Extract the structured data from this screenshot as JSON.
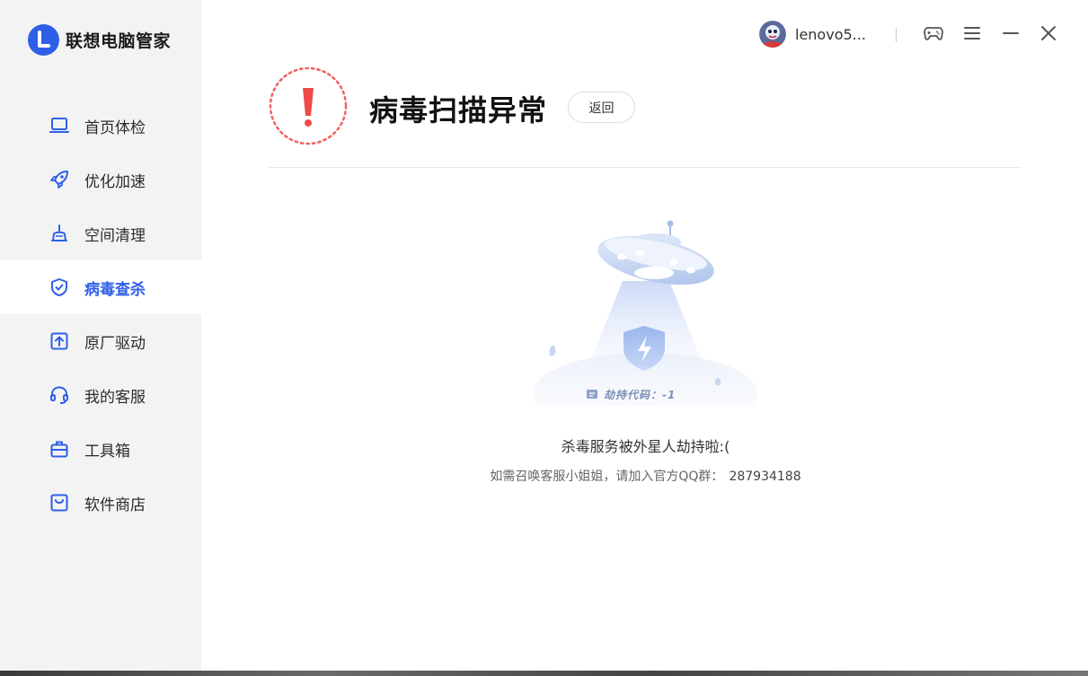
{
  "app": {
    "name": "联想电脑管家"
  },
  "colors": {
    "accent": "#2f5fe8",
    "danger": "#f04a4a",
    "sidebar_bg": "#f3f3f3"
  },
  "sidebar": {
    "items": [
      {
        "label": "首页体检",
        "icon": "laptop-icon",
        "active": false
      },
      {
        "label": "优化加速",
        "icon": "rocket-icon",
        "active": false
      },
      {
        "label": "空间清理",
        "icon": "broom-icon",
        "active": false
      },
      {
        "label": "病毒查杀",
        "icon": "shield-icon",
        "active": true
      },
      {
        "label": "原厂驱动",
        "icon": "upload-box-icon",
        "active": false
      },
      {
        "label": "我的客服",
        "icon": "headset-icon",
        "active": false
      },
      {
        "label": "工具箱",
        "icon": "toolbox-icon",
        "active": false
      },
      {
        "label": "软件商店",
        "icon": "store-bag-icon",
        "active": false
      }
    ]
  },
  "titlebar": {
    "username": "lenovo5...",
    "buttons": [
      "gamepad-icon",
      "menu-icon",
      "minimize-icon",
      "close-icon"
    ]
  },
  "header": {
    "title": "病毒扫描异常",
    "back_label": "返回"
  },
  "illustration": {
    "hijack_code": "劫持代码：-1"
  },
  "main": {
    "message": "杀毒服务被外星人劫持啦:(",
    "contact_text": "如需召唤客服小姐姐，请加入官方QQ群：",
    "qq_group": "287934188"
  }
}
